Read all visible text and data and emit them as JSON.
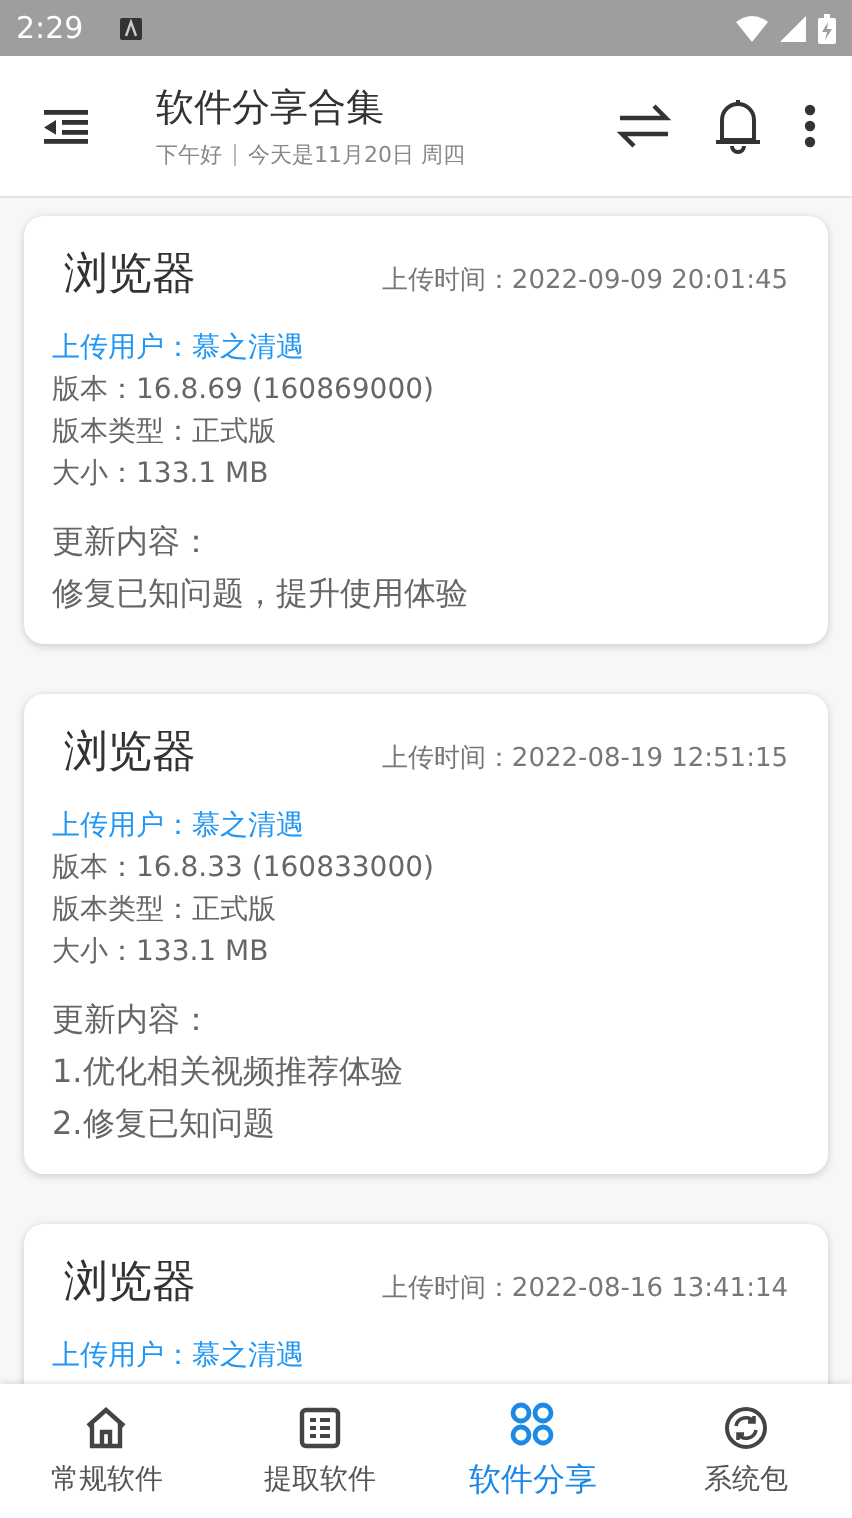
{
  "status_bar": {
    "time": "2:29"
  },
  "header": {
    "title": "软件分享合集",
    "greeting": "下午好",
    "date": "今天是11月20日 周四"
  },
  "cards": [
    {
      "name": "浏览器",
      "upload_time": "上传时间：2022-09-09 20:01:45",
      "user": "上传用户：慕之清遇",
      "details": [
        "版本：16.8.69 (160869000)",
        "版本类型：正式版",
        "大小：133.1 MB"
      ],
      "notes_label": "更新内容：",
      "notes": [
        "修复已知问题，提升使用体验"
      ]
    },
    {
      "name": "浏览器",
      "upload_time": "上传时间：2022-08-19 12:51:15",
      "user": "上传用户：慕之清遇",
      "details": [
        "版本：16.8.33 (160833000)",
        "版本类型：正式版",
        "大小：133.1 MB"
      ],
      "notes_label": "更新内容：",
      "notes": [
        "1.优化相关视频推荐体验",
        "2.修复已知问题"
      ]
    },
    {
      "name": "浏览器",
      "upload_time": "上传时间：2022-08-16 13:41:14",
      "user": "上传用户：慕之清遇"
    }
  ],
  "bottom_nav": [
    {
      "kind": "home",
      "label": "常规软件",
      "selected": false
    },
    {
      "kind": "list",
      "label": "提取软件",
      "selected": false
    },
    {
      "kind": "apps",
      "label": "软件分享",
      "selected": true
    },
    {
      "kind": "sync",
      "label": "系统包",
      "selected": false
    }
  ]
}
